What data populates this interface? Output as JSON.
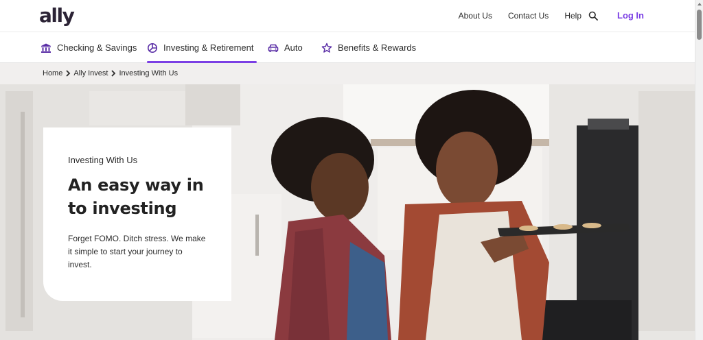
{
  "header": {
    "logo": "ally",
    "links": [
      "About Us",
      "Contact Us",
      "Help"
    ],
    "search_icon": "search-icon",
    "login": "Log In"
  },
  "nav": {
    "items": [
      {
        "label": "Checking & Savings",
        "icon": "bank-icon"
      },
      {
        "label": "Investing & Retirement",
        "icon": "pie-chart-icon",
        "active": true
      },
      {
        "label": "Auto",
        "icon": "car-icon"
      },
      {
        "label": "Benefits & Rewards",
        "icon": "star-icon"
      }
    ]
  },
  "breadcrumb": [
    "Home",
    "Ally Invest",
    "Investing With Us"
  ],
  "hero": {
    "eyebrow": "Investing With Us",
    "headline_line1": "An easy way in",
    "headline_line2": "to investing",
    "body": "Forget FOMO. Ditch stress. We make it simple to start your journey to invest."
  },
  "colors": {
    "brand": "#7b3fe4",
    "logo": "#2b2335",
    "crumb_bg": "#f1efee"
  }
}
